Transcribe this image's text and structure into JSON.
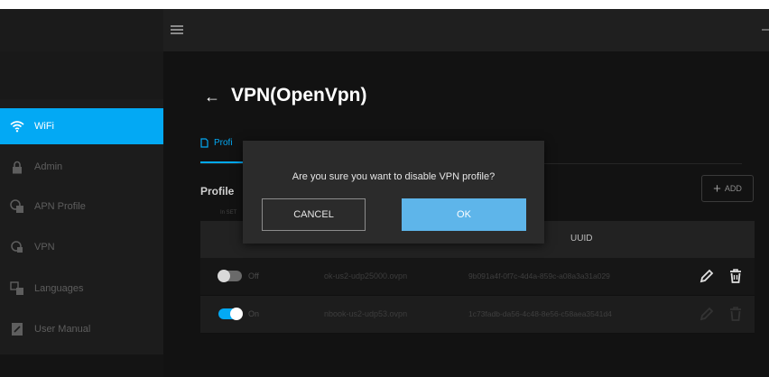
{
  "header": {
    "menu_icon": "hamburger-icon"
  },
  "sidebar": {
    "items": [
      {
        "label": "WiFi",
        "icon": "wifi-icon",
        "active": true
      },
      {
        "label": "Admin",
        "icon": "lock-icon"
      },
      {
        "label": "APN Profile",
        "icon": "apn-icon"
      },
      {
        "label": "VPN",
        "icon": "vpn-icon"
      },
      {
        "label": "Languages",
        "icon": "language-icon"
      },
      {
        "label": "User Manual",
        "icon": "manual-icon"
      }
    ]
  },
  "main": {
    "back_arrow": "←",
    "title": "VPN(OpenVpn)",
    "tab_label": "Profi",
    "profile_label": "Profile",
    "profile_sub": "In SET",
    "add_label": "ADD",
    "table": {
      "uuid_header": "UUID",
      "rows": [
        {
          "state": "Off",
          "file": "ok-us2-udp25000.ovpn",
          "uuid": "9b091a4f-0f7c-4d4a-859c-a08a3a31a029",
          "enabled": false
        },
        {
          "state": "On",
          "file": "nbook-us2-udp53.ovpn",
          "uuid": "1c73fadb-da56-4c48-8e56-c58aea3541d4",
          "enabled": true
        }
      ]
    }
  },
  "dialog": {
    "message": "Are you sure you want to disable VPN profile?",
    "cancel_label": "CANCEL",
    "ok_label": "OK"
  },
  "colors": {
    "accent": "#03a9f4",
    "ok_button": "#5eb5ea",
    "background": "#121212"
  }
}
